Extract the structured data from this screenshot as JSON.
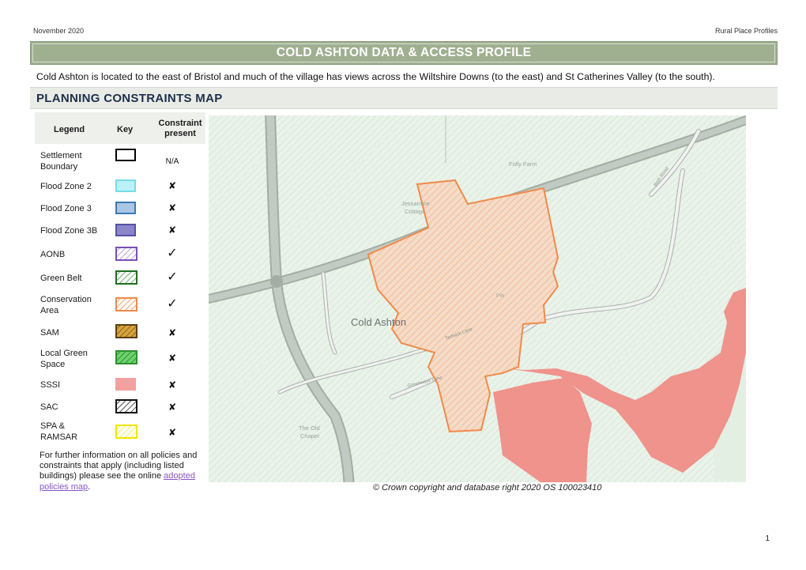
{
  "header": {
    "date": "November 2020",
    "series": "Rural Place Profiles"
  },
  "title": "COLD ASHTON DATA & ACCESS PROFILE",
  "intro": "Cold Ashton is located to the east of Bristol and much of the village has views across the Wiltshire Downs (to the east) and St Catherines Valley (to the south).",
  "section_title": "PLANNING CONSTRAINTS MAP",
  "legend": {
    "col_legend": "Legend",
    "col_key": "Key",
    "col_present": "Constraint present",
    "items": [
      {
        "label": "Settlement Boundary",
        "present": "N/A"
      },
      {
        "label": "Flood Zone 2",
        "present": "✘"
      },
      {
        "label": "Flood Zone 3",
        "present": "✘"
      },
      {
        "label": "Flood Zone 3B",
        "present": "✘"
      },
      {
        "label": "AONB",
        "present": "✓"
      },
      {
        "label": "Green Belt",
        "present": "✓"
      },
      {
        "label": "Conservation Area",
        "present": "✓"
      },
      {
        "label": "SAM",
        "present": "✘"
      },
      {
        "label": "Local Green Space",
        "present": "✘"
      },
      {
        "label": "SSSI",
        "present": "✘"
      },
      {
        "label": "SAC",
        "present": "✘"
      },
      {
        "label": "SPA & RAMSAR",
        "present": "✘"
      }
    ]
  },
  "further_info": {
    "text": "For further information on all policies and constraints that apply (including listed buildings) please see the online",
    "link": "adopted policies map",
    "end": "."
  },
  "map": {
    "labels": {
      "folly_farm": "Folly Farm",
      "jessamine_1": "Jessamine",
      "jessamine_2": "Cottage",
      "cold_ashton": "Cold Ashton",
      "old_chapel_1": "The Old",
      "old_chapel_2": "Chapel",
      "pw": "PW",
      "road1": "Greenways Lane",
      "road2": "Tadwick Lane",
      "road3": "Bath Road"
    },
    "colors": {
      "background": "#e8f1e8",
      "road_fill": "#bfc8c0",
      "road_edge": "#a3ada4",
      "conservation_stroke": "#f08a4b",
      "conservation_fill": "#f5d8c4",
      "sssi_fill": "#ef8d87",
      "greenbelt_hatch": "#cfe3cf"
    }
  },
  "copyright": "© Crown copyright and database right 2020 OS 100023410",
  "page_number": "1"
}
